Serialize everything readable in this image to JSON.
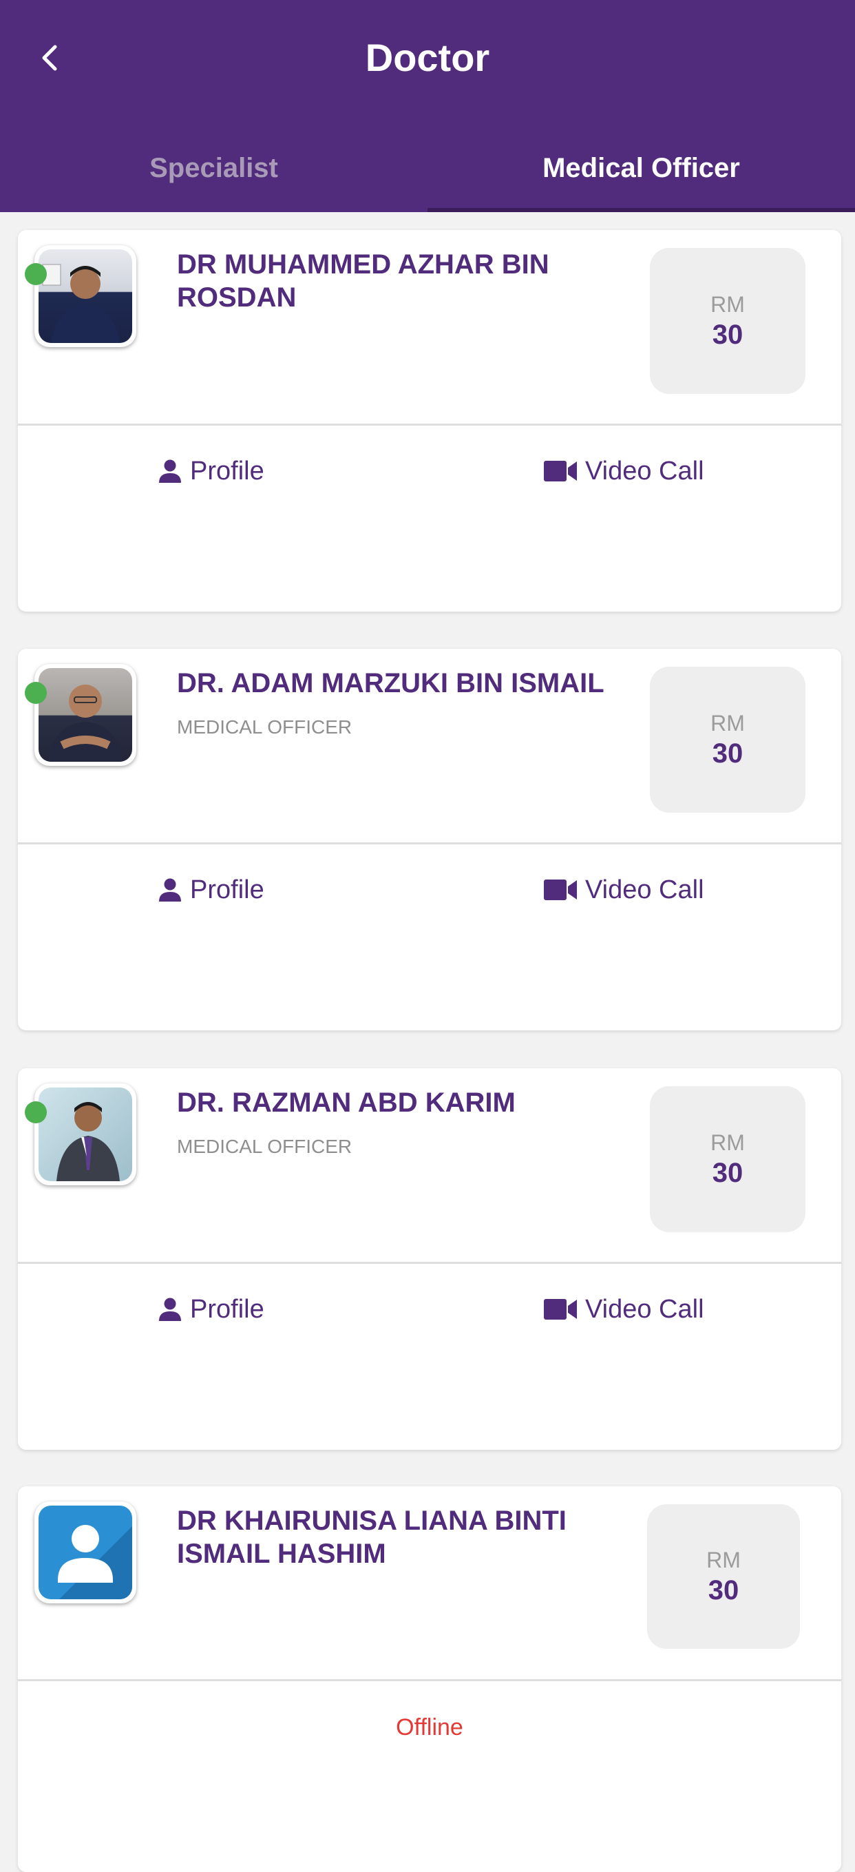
{
  "header": {
    "title": "Doctor",
    "back_icon": "chevron-left-icon"
  },
  "tabs": [
    {
      "label": "Specialist",
      "active": false
    },
    {
      "label": "Medical Officer",
      "active": true
    }
  ],
  "colors": {
    "primary": "#522c7c",
    "online": "#4caf50",
    "offline": "#e53935",
    "price_bg": "#eeeeee"
  },
  "doctors": [
    {
      "name": "DR MUHAMMED AZHAR BIN ROSDAN",
      "role": "",
      "online": true,
      "currency": "RM",
      "price": "30",
      "profile_label": "Profile",
      "video_label": "Video Call"
    },
    {
      "name": "DR. ADAM MARZUKI BIN ISMAIL",
      "role": "MEDICAL OFFICER",
      "online": true,
      "currency": "RM",
      "price": "30",
      "profile_label": "Profile",
      "video_label": "Video Call"
    },
    {
      "name": "DR. RAZMAN ABD KARIM",
      "role": "MEDICAL OFFICER",
      "online": true,
      "currency": "RM",
      "price": "30",
      "profile_label": "Profile",
      "video_label": "Video Call"
    },
    {
      "name": "DR KHAIRUNISA LIANA BINTI ISMAIL HASHIM",
      "role": "",
      "online": false,
      "currency": "RM",
      "price": "30",
      "status_label": "Offline"
    }
  ]
}
